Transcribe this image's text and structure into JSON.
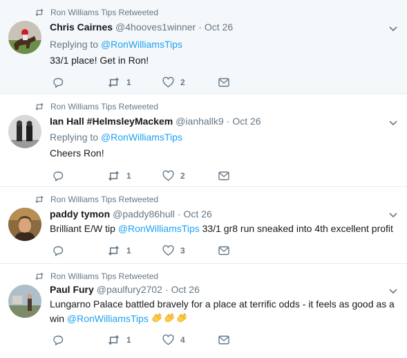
{
  "colors": {
    "accent": "#1da1f2",
    "muted": "#657786",
    "text": "#14171a",
    "highlight_bg": "#f5f8fa"
  },
  "tweets": [
    {
      "retweeted_by": "Ron Williams Tips Retweeted",
      "name": "Chris Cairnes",
      "handle": "@4hooves1winner",
      "dot": "·",
      "time": "Oct 26",
      "replying_prefix": "Replying to ",
      "replying_to": "@RonWilliamsTips",
      "text": "33/1 place! Get in Ron!",
      "retweets": "1",
      "likes": "2",
      "icons": [
        "reply-icon",
        "retweet-icon",
        "heart-icon",
        "mail-icon",
        "chevron-down-icon"
      ]
    },
    {
      "retweeted_by": "Ron Williams Tips Retweeted",
      "name": "Ian Hall #HelmsleyMackem",
      "handle": "@ianhallk9",
      "dot": "·",
      "time": "Oct 26",
      "replying_prefix": "Replying to ",
      "replying_to": "@RonWilliamsTips",
      "text": "Cheers Ron!",
      "retweets": "1",
      "likes": "2",
      "icons": [
        "reply-icon",
        "retweet-icon",
        "heart-icon",
        "mail-icon",
        "chevron-down-icon"
      ]
    },
    {
      "retweeted_by": "Ron Williams Tips Retweeted",
      "name": "paddy tymon",
      "handle": "@paddy86hull",
      "dot": "·",
      "time": "Oct 26",
      "text_before": "Brilliant E/W tip ",
      "text_mention": "@RonWilliamsTips",
      "text_after": " 33/1 gr8 run sneaked into 4th excellent profit",
      "retweets": "1",
      "likes": "3",
      "icons": [
        "reply-icon",
        "retweet-icon",
        "heart-icon",
        "mail-icon",
        "chevron-down-icon"
      ]
    },
    {
      "retweeted_by": "Ron Williams Tips Retweeted",
      "name": "Paul Fury",
      "handle": "@paulfury2702",
      "dot": "·",
      "time": "Oct 26",
      "text_line1": "Lungarno Palace battled bravely for a place at terrific odds - it feels as good as a",
      "text_line2_prefix": "win ",
      "text_mention": "@RonWilliamsTips",
      "emoji": "clapping-hands-emoji",
      "retweets": "1",
      "likes": "4",
      "icons": [
        "reply-icon",
        "retweet-icon",
        "heart-icon",
        "mail-icon",
        "chevron-down-icon"
      ]
    }
  ]
}
